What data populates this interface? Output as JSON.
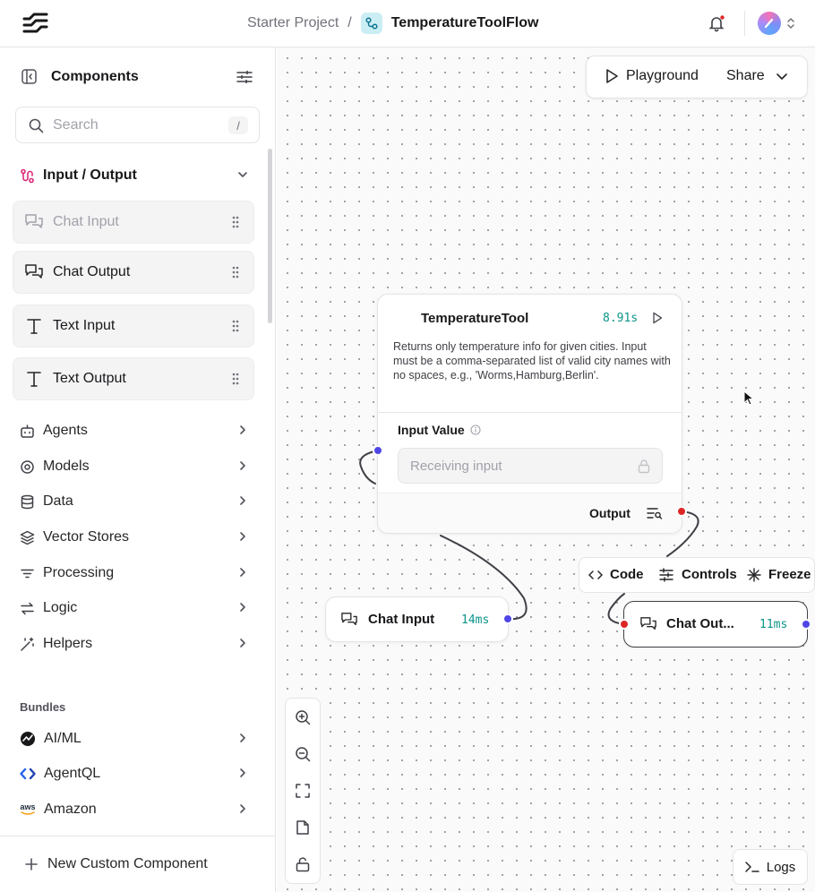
{
  "header": {
    "project": "Starter Project",
    "separator": "/",
    "flow_name": "TemperatureToolFlow"
  },
  "sidebar": {
    "title": "Components",
    "search": {
      "placeholder": "Search",
      "shortcut": "/"
    },
    "section": "Input / Output",
    "io_components": [
      {
        "label": "Chat Input",
        "icon": "chat-bubbles-icon",
        "disabled": true
      },
      {
        "label": "Chat Output",
        "icon": "chat-bubbles-icon"
      },
      {
        "label": "Text Input",
        "icon": "text-t-icon"
      },
      {
        "label": "Text Output",
        "icon": "text-t-icon"
      }
    ],
    "categories": [
      {
        "label": "Agents",
        "icon": "bot-icon"
      },
      {
        "label": "Models",
        "icon": "brain-circuit-icon"
      },
      {
        "label": "Data",
        "icon": "database-icon"
      },
      {
        "label": "Vector Stores",
        "icon": "layers-icon"
      },
      {
        "label": "Processing",
        "icon": "filter-lines-icon"
      },
      {
        "label": "Logic",
        "icon": "arrows-swap-icon"
      },
      {
        "label": "Helpers",
        "icon": "magic-wand-icon"
      }
    ],
    "bundles_heading": "Bundles",
    "bundles": [
      {
        "label": "AI/ML",
        "icon": "aiml-logo-icon"
      },
      {
        "label": "AgentQL",
        "icon": "agentql-logo-icon"
      },
      {
        "label": "Amazon",
        "icon": "aws-logo-icon"
      }
    ],
    "aws_logo_text": "aws",
    "new_component": "New Custom Component"
  },
  "canvas": {
    "playground": "Playground",
    "share": "Share",
    "temperature_node": {
      "title": "TemperatureTool",
      "time": "8.91s",
      "description": "Returns only temperature info for given cities. Input must be a comma-separated list of valid city names with no spaces, e.g., 'Worms,Hamburg,Berlin'.",
      "input_label": "Input Value",
      "input_placeholder": "Receiving input",
      "output_label": "Output"
    },
    "chat_input_node": {
      "title": "Chat Input",
      "time": "14ms"
    },
    "chat_output_node": {
      "title": "Chat Out...",
      "time": "11ms"
    },
    "node_toolbar": {
      "code": "Code",
      "controls": "Controls",
      "freeze": "Freeze"
    },
    "logs": "Logs"
  },
  "colors": {
    "accent_blue": "#4f46e5",
    "handle_red": "#dc2626",
    "time_teal": "#0d9488"
  }
}
